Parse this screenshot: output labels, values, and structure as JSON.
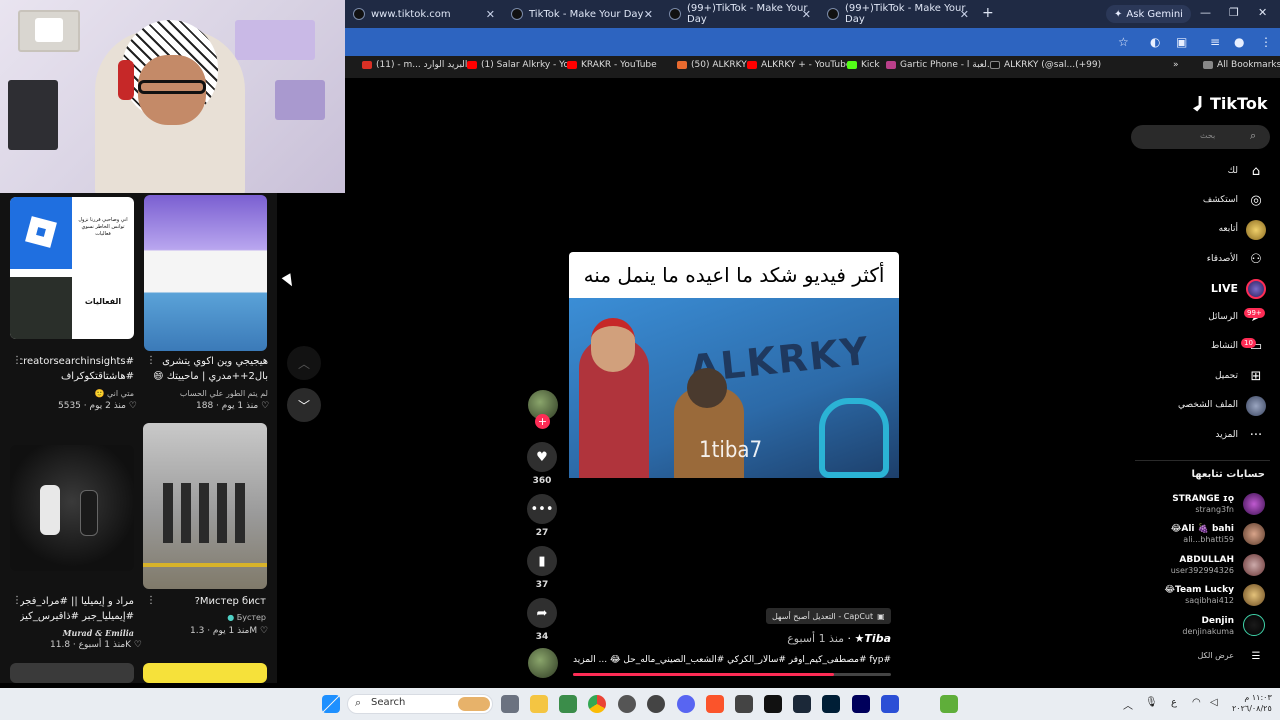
{
  "browser": {
    "tabs": [
      {
        "label": "www.tiktok.com"
      },
      {
        "label": "TikTok - Make Your Day"
      },
      {
        "label": "(99+)TikTok - Make Your Day"
      },
      {
        "label": "(99+)TikTok - Make Your Day"
      }
    ],
    "new_tab": "+",
    "ask_gemini": "Ask Gemini",
    "bookmarks": [
      {
        "label": "(11) - m... البريد الوارد",
        "color": "#d93025"
      },
      {
        "label": "(1) Salar Alkrky - Yo...",
        "color": "#ff0000"
      },
      {
        "label": "KRAKR - YouTube",
        "color": "#ff0000"
      },
      {
        "label": "(50) ALKRKY",
        "color": "#e86a2f"
      },
      {
        "label": "ALKRKY + - YouTube",
        "color": "#ff0000"
      },
      {
        "label": "Kick",
        "color": "#53fc18"
      },
      {
        "label": "Gartic Phone - لعبة ا...",
        "color": "#b93f8a"
      },
      {
        "label": "ALKRKY (@sal...(+99)",
        "color": "#111111"
      }
    ],
    "all_bookmarks": "All Bookmarks"
  },
  "left_panel": {
    "cards": [
      {
        "title": "#creatorsearchinsights",
        "sub": "#هاشتاقتكوكراف",
        "author": "متي اني 🙂",
        "likes": "5535",
        "age": "منذ 2 يوم"
      },
      {
        "title": "هيجيجي وين اكوي يتشرى",
        "sub": "بال2++مدري | ماحييتك 😄 ...",
        "author": "لم يتم الطور علي الحساب",
        "likes": "188",
        "age": "منذ 1 يوم"
      },
      {
        "title": "مراد و إيميليا || #مراد_فجر",
        "sub": "#إيميليا_جبر #ذاقيرس_كيز...",
        "author": "Murad & Emilia",
        "likes": "11.8K",
        "age": "منذ 1 أسبوع"
      },
      {
        "title": "Мистер бист?",
        "sub": "",
        "author": "Бустер",
        "likes": "1.3M",
        "age": "منذ 1 يوم"
      }
    ],
    "thumb_text": {
      "roblox_caption": "الفعاليات",
      "roblox_note": "اني وصاحبي قررنا نزول توانس الخاطر نسوي فعاليات"
    }
  },
  "video": {
    "caption": "أكثر فيديو شكد ما اعيده ما ينمل منه",
    "logo": "ALKRKY",
    "watermark": "1tiba7",
    "likes": "360",
    "comments": "27",
    "saves": "37",
    "shares": "34",
    "capcut": "CapCut - التعديل أصبح أسهل",
    "author": "Tiba★",
    "age": "منذ 1 أسبوع",
    "description": "#fyp #مصطفى_كيم_اوفر #سالار_الكركي #الشعب_الصيني_ماله_حل 😂 ... المزيد",
    "progress": 0.82
  },
  "sidebar": {
    "logo": "TikTok",
    "search_placeholder": "بحث",
    "items": [
      {
        "label": "لك"
      },
      {
        "label": "استكشف"
      },
      {
        "label": "أتابعه"
      },
      {
        "label": "الأصدقاء"
      },
      {
        "label": "LIVE"
      },
      {
        "label": "الرسائل",
        "badge": "99+"
      },
      {
        "label": "النشاط",
        "badge": "10"
      },
      {
        "label": "تحميل"
      },
      {
        "label": "الملف الشخصي"
      },
      {
        "label": "المزيد"
      }
    ],
    "following_title": "حسابات تتابعها",
    "following": [
      {
        "name": "STRANGE ɪǫ",
        "handle": "strang3fn"
      },
      {
        "name": "😂Ali 🍇 bahi",
        "handle": "ali...bhatti59"
      },
      {
        "name": "ABDULLAH",
        "handle": "user392994326"
      },
      {
        "name": "😂Team Lucky",
        "handle": "saqibhai412"
      },
      {
        "name": "Denjin",
        "handle": "denjinakuma"
      }
    ],
    "see_all": "عرض الكل"
  },
  "taskbar": {
    "search": "Search",
    "clock_time": "١١:٠٣ م",
    "clock_date": "٢٠٢٦/٠٨/٢٥",
    "lang": "ع"
  }
}
